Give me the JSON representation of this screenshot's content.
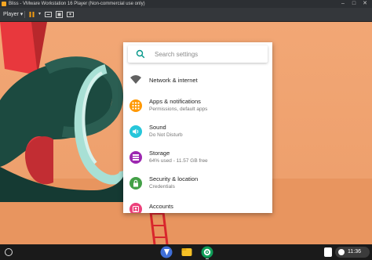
{
  "window": {
    "title": "Bliss - VMware Workstation 16 Player (Non-commercial use only)"
  },
  "toolbar": {
    "player_label": "Player"
  },
  "settings": {
    "search_placeholder": "Search settings",
    "items": [
      {
        "title": "Network & internet",
        "subtitle": "",
        "icon": "wifi-icon",
        "color": "#ffffff"
      },
      {
        "title": "Apps & notifications",
        "subtitle": "Permissions, default apps",
        "icon": "apps-icon",
        "color": "#ff9800"
      },
      {
        "title": "Sound",
        "subtitle": "Do Not Disturb",
        "icon": "volume-icon",
        "color": "#26c6da"
      },
      {
        "title": "Storage",
        "subtitle": "64% used - 11.57 GB free",
        "icon": "storage-icon",
        "color": "#9c27b0"
      },
      {
        "title": "Security & location",
        "subtitle": "Credentials",
        "icon": "lock-icon",
        "color": "#43a047"
      },
      {
        "title": "Accounts",
        "subtitle": "",
        "icon": "accounts-icon",
        "color": "#ec407a"
      }
    ]
  },
  "shelf": {
    "time": "11:36"
  },
  "colors": {
    "accent": "#009688",
    "wallpaper": "#f0a470"
  }
}
